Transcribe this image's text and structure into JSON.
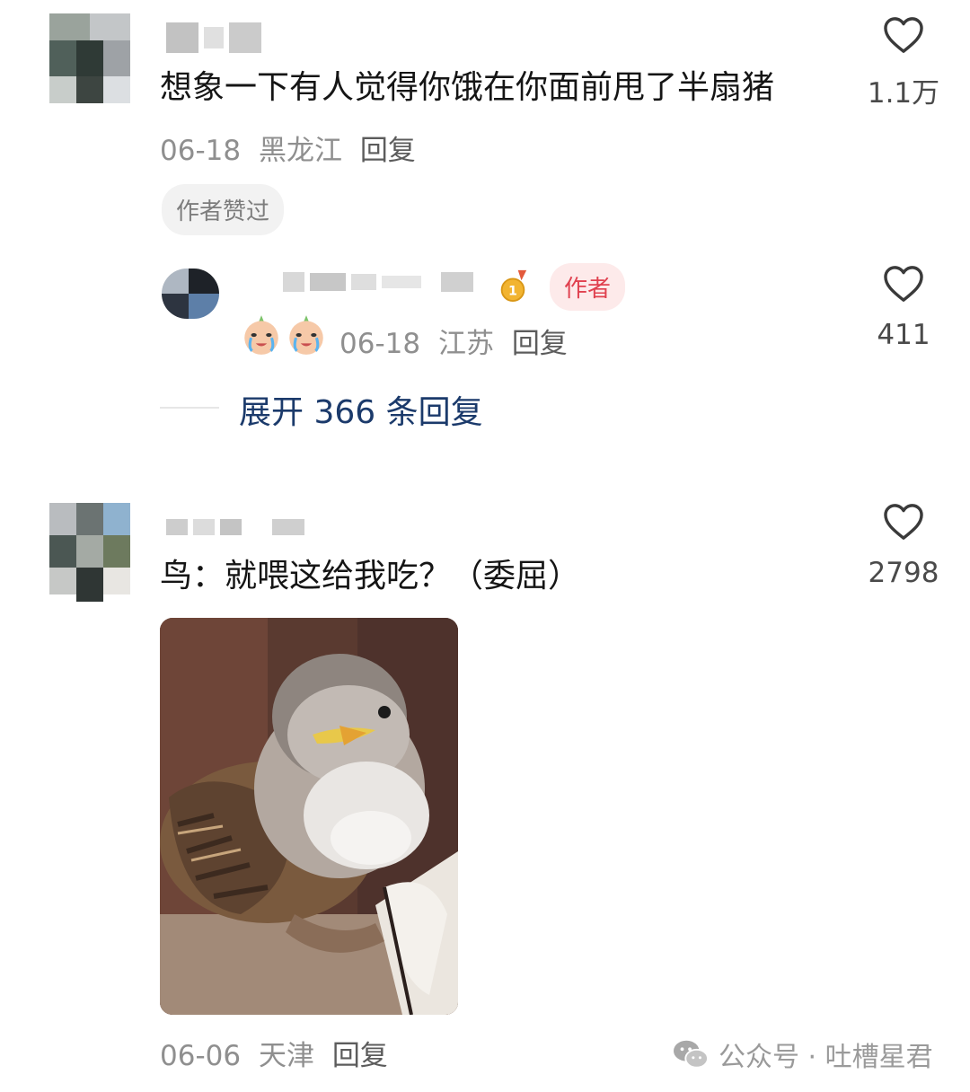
{
  "comments": [
    {
      "text": "想象一下有人觉得你饿在你面前甩了半扇猪",
      "date": "06-18",
      "location": "黑龙江",
      "reply_label": "回复",
      "likes": "1.1万",
      "badge": "作者赞过",
      "reply": {
        "author_tag": "作者",
        "date": "06-18",
        "location": "江苏",
        "reply_label": "回复",
        "likes": "411"
      },
      "expand_label": "展开 366 条回复"
    },
    {
      "text": "鸟：就喂这给我吃？（委屈）",
      "date": "06-06",
      "location": "天津",
      "reply_label": "回复",
      "likes": "2798"
    }
  ],
  "footer": {
    "brand": "公众号 · 吐槽星君",
    "brand_icon": "wechat-icon"
  },
  "icons": {
    "like": "heart-outline-icon",
    "medal": "gold-medal-icon",
    "emoji": "crying-face-icon"
  },
  "colors": {
    "author_tag_bg": "#fdeaea",
    "author_tag_text": "#e0414f",
    "expand_text": "#1b3a6b"
  }
}
